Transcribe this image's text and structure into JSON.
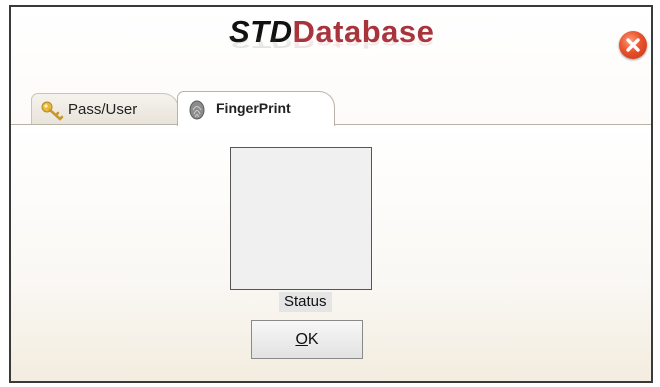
{
  "header": {
    "logo_part1": "STD",
    "logo_part2": "Database",
    "close_icon": "close-icon",
    "close_color": "#e8512c"
  },
  "tabs": [
    {
      "label": "Pass/User",
      "icon": "key-icon",
      "active": false
    },
    {
      "label": "FingerPrint",
      "icon": "fingerprint-icon",
      "active": true
    }
  ],
  "panel": {
    "status_text": "Status",
    "ok_mnemonic": "O",
    "ok_rest": "K"
  },
  "colors": {
    "logo_accent": "#a8333a",
    "border": "#3a3a3a"
  }
}
